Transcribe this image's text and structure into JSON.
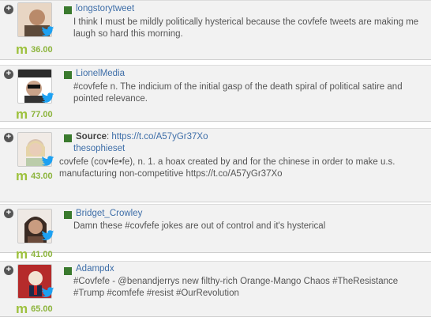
{
  "items": [
    {
      "handle": "longstorytweet",
      "text": "I think I must be mildly politically hysterical because the covfefe tweets are making me laugh so hard this morning.",
      "score": "36.00",
      "score_icon": "m-icon",
      "avatar_color": "#b98a6a"
    },
    {
      "handle": "LionelMedia",
      "text": "#covfefe n. The indicium of the initial gasp of the death spiral of political satire and pointed relevance.",
      "score": "77.00",
      "score_icon": "m-icon",
      "avatar_color": "#2b2b2b"
    },
    {
      "source_label": "Source",
      "source_url": "https://t.co/A57yGr37Xo",
      "handle": "thesophieset",
      "text": "covfefe (cov•fe•fe), n. 1. a hoax created by and for the chinese in order to make u.s. manufacturing non-competitive https://t.co/A57yGr37Xo",
      "score": "43.00",
      "score_icon": "m-icon",
      "avatar_color": "#d9c2b0"
    },
    {
      "handle": "Bridget_Crowley",
      "text": "Damn these #covfefe jokes are out of control and it's hysterical",
      "score": "41.00",
      "score_icon": "m-icon",
      "avatar_color": "#6b4a3a"
    },
    {
      "handle": "Adampdx",
      "text": "#Covfefe - @benandjerrys new filthy-rich Orange-Mango Chaos #TheResistance #Trump #comfefe #resist #OurRevolution",
      "score": "65.00",
      "score_icon": "m-icon",
      "avatar_color": "#b52b2b"
    }
  ],
  "colors": {
    "handle": "#3e6ea8",
    "score": "#8cb43c",
    "marker": "#3a7a2e",
    "card_bg": "#f2f2f2"
  }
}
